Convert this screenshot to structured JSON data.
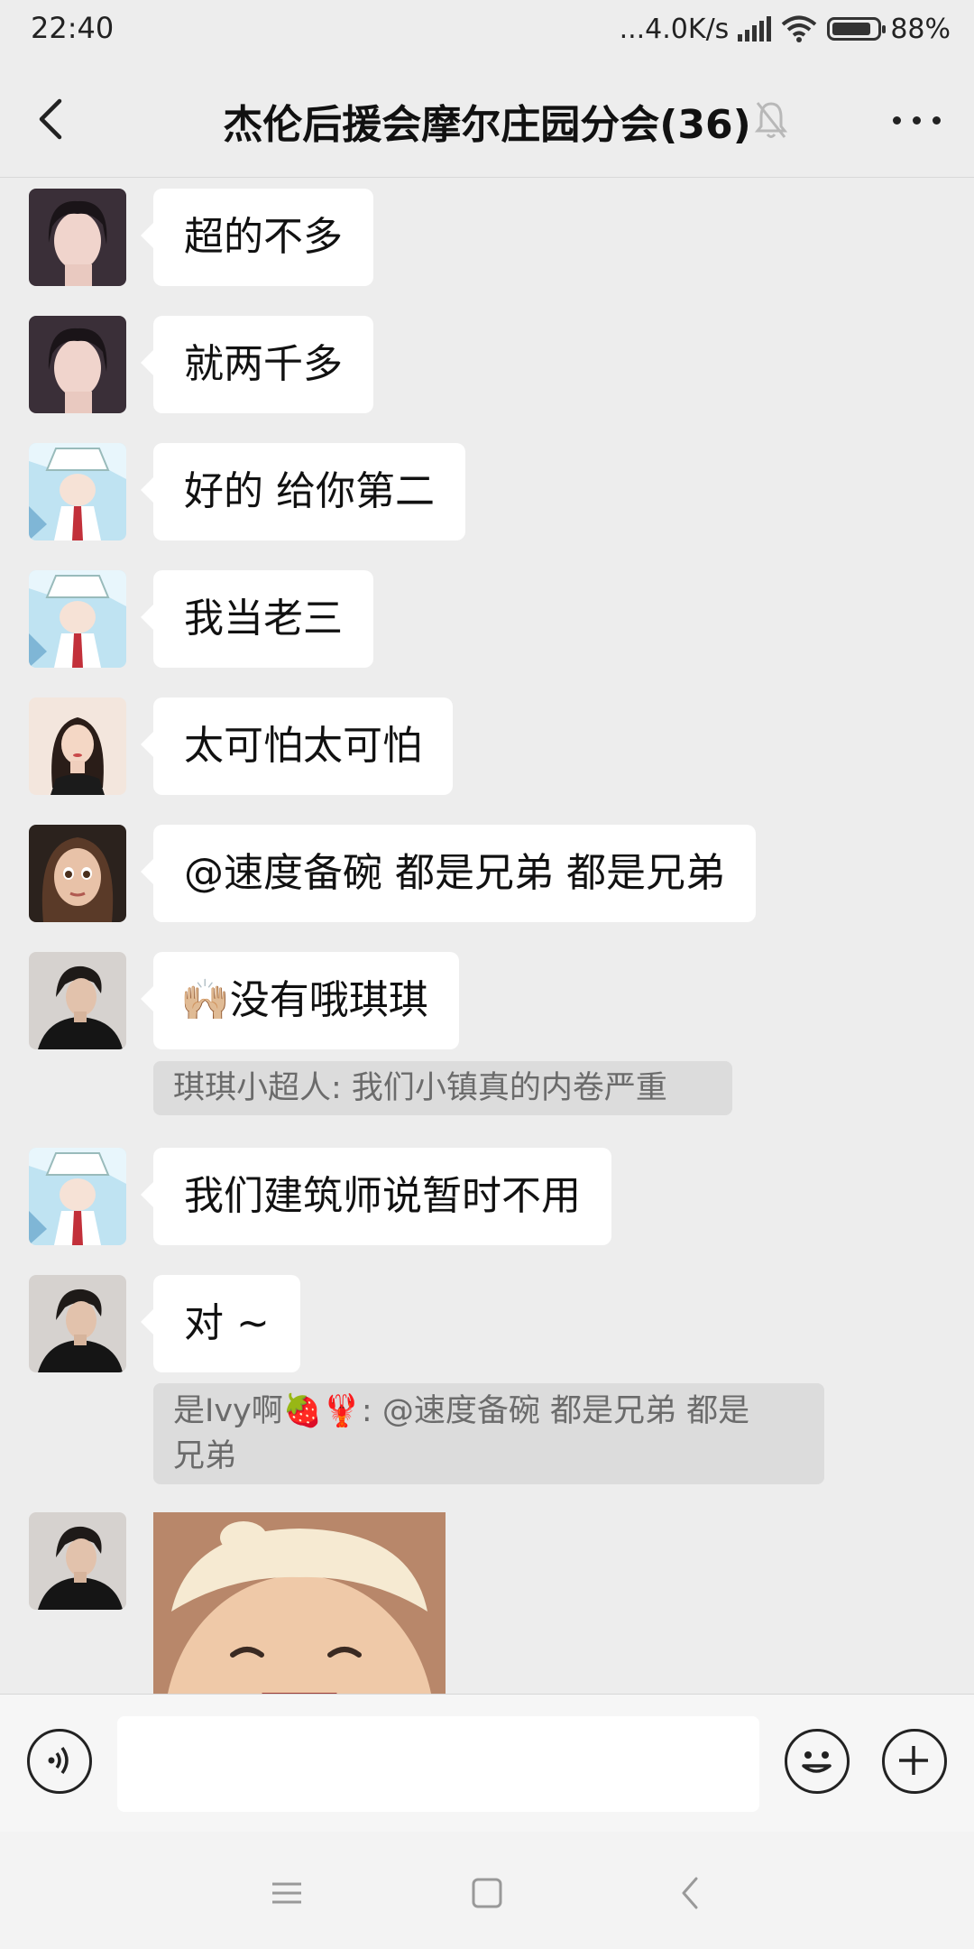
{
  "status_bar": {
    "time": "22:40",
    "net_speed": "...4.0K/s",
    "battery": "88%",
    "battery_level": 0.88,
    "icons": [
      "signal-icon",
      "wifi-icon",
      "battery-icon"
    ]
  },
  "header": {
    "title": "杰伦后援会摩尔庄园分会(36)",
    "icons": [
      "back-icon",
      "mute-bell-icon",
      "more-icon"
    ]
  },
  "messages": [
    {
      "text": "超的不多",
      "avatar": "avatar-girl-1"
    },
    {
      "text": "就两千多",
      "avatar": "avatar-girl-1"
    },
    {
      "text": "好的 给你第二",
      "avatar": "avatar-kid-thief"
    },
    {
      "text": "我当老三",
      "avatar": "avatar-kid-thief"
    },
    {
      "text": "太可怕太可怕",
      "avatar": "avatar-cartoon-woman"
    },
    {
      "text": "@速度备碗  都是兄弟 都是兄弟",
      "avatar": "avatar-3d-girl"
    },
    {
      "emoji": "🙌🏼",
      "text": "没有哦琪琪",
      "avatar": "avatar-man",
      "quote": "琪琪小超人: 我们小镇真的内卷严重"
    },
    {
      "text": "我们建筑师说暂时不用",
      "avatar": "avatar-kid-thief"
    },
    {
      "text": "对 ~",
      "avatar": "avatar-man",
      "quote_line1": "是Ivy啊🍓🦞: @速度备碗 都是兄弟 都是",
      "quote_line2": "兄弟"
    },
    {
      "image": "sticker-child-headband",
      "avatar": "avatar-man"
    }
  ],
  "input_bar": {
    "placeholder": "",
    "icons": [
      "voice-icon",
      "emoji-icon",
      "plus-icon"
    ]
  },
  "system_nav": {
    "icons": [
      "menu-icon",
      "home-icon",
      "back-nav-icon"
    ]
  },
  "colors": {
    "background": "#ededed",
    "bubble": "#ffffff",
    "quote": "#dcdcdc"
  }
}
